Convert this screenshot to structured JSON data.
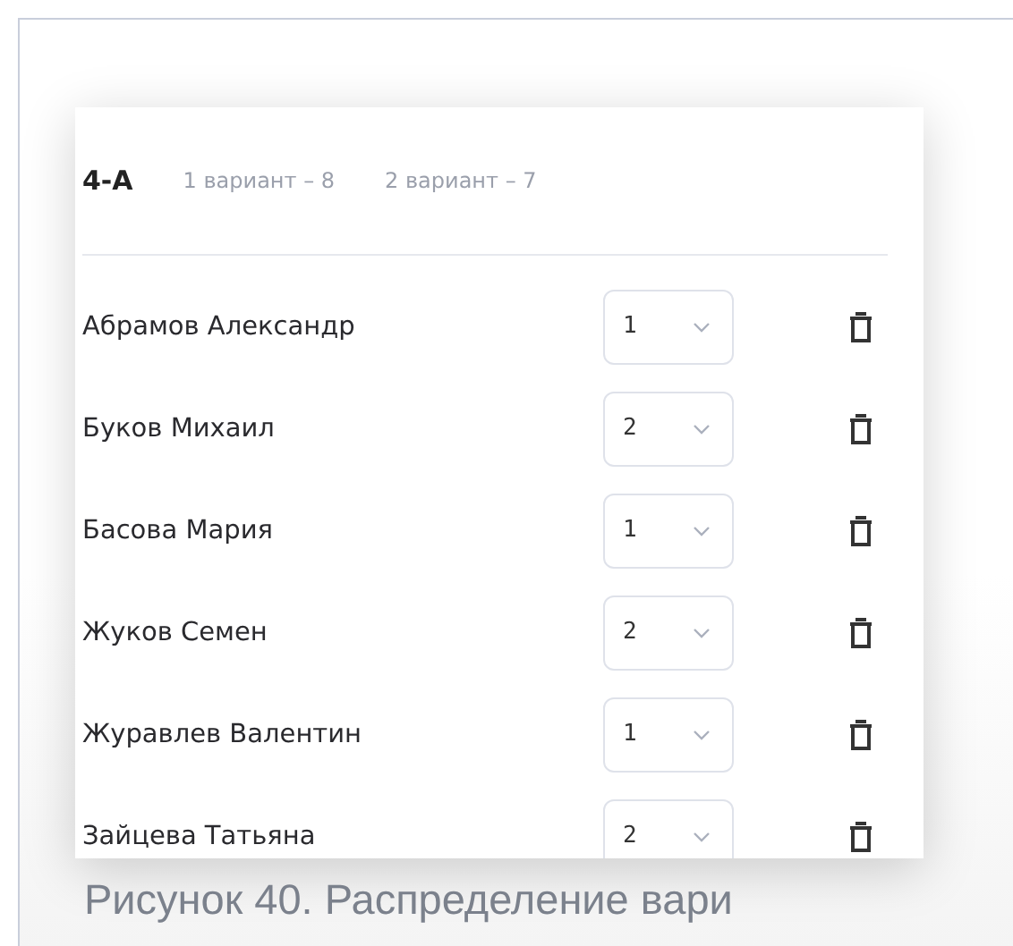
{
  "header": {
    "class_name": "4-А",
    "variant_counts": [
      "1 вариант – 8",
      "2 вариант – 7"
    ]
  },
  "students": [
    {
      "name": "Абрамов Александр",
      "variant": "1"
    },
    {
      "name": "Буков Михаил",
      "variant": "2"
    },
    {
      "name": "Басова Мария",
      "variant": "1"
    },
    {
      "name": "Жуков Семен",
      "variant": "2"
    },
    {
      "name": "Журавлев Валентин",
      "variant": "1"
    },
    {
      "name": "Зайцева Татьяна",
      "variant": "2"
    }
  ],
  "caption": "Рисунок 40. Распределение вари"
}
